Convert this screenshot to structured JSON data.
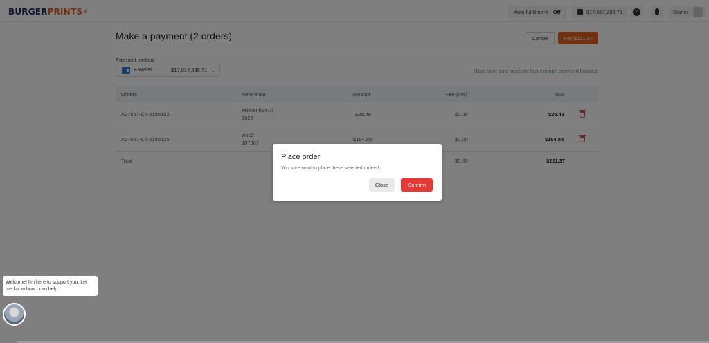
{
  "header": {
    "logo": {
      "part1": "BURGER",
      "part2": "PRINTS",
      "mark": "⚡"
    },
    "auto_fulfillment": {
      "label": "Auto fulfillment ·",
      "value": "Off"
    },
    "balance": "$17,017,285.71",
    "balance_icon": "wallet-icon",
    "help_icon": "question-icon",
    "mic_icon": "microphone-icon",
    "plan": "Starter"
  },
  "page": {
    "title": "Make a payment (2 orders)",
    "cancel_label": "Cancel",
    "pay_label": "Pay $221.37",
    "payment_method_label": "Payment method",
    "payment_method": {
      "name": "B-Wallet",
      "amount": "$17,017,285.71"
    },
    "note": "Make sure your account has enough payment balance"
  },
  "table": {
    "headers": {
      "orders": "Orders",
      "reference": "Reference",
      "amount": "Amount",
      "fee": "Fee (0%)",
      "total": "Total"
    },
    "rows": [
      {
        "order": "A27657-CT-2186152",
        "ref1": "Minhanh1410",
        "ref2": "1025",
        "amount": "$26.49",
        "fee": "$0.00",
        "total": "$26.49"
      },
      {
        "order": "A27657-CT-2186125",
        "ref1": "woo2",
        "ref2": "107567",
        "amount": "$194.88",
        "fee": "$0.00",
        "total": "$194.88"
      }
    ],
    "footer": {
      "label": "Total",
      "fee": "$0.00",
      "total": "$221.37"
    }
  },
  "modal": {
    "title": "Place order",
    "message": "You sure want to place these selected orders!",
    "close_label": "Close",
    "confirm_label": "Confirm"
  },
  "chat": {
    "message": "Welcome! I'm here to support you. Let me know how I can help."
  },
  "colors": {
    "brand_orange": "#e2621b",
    "brand_navy": "#1d2a57",
    "danger": "#e53935"
  }
}
